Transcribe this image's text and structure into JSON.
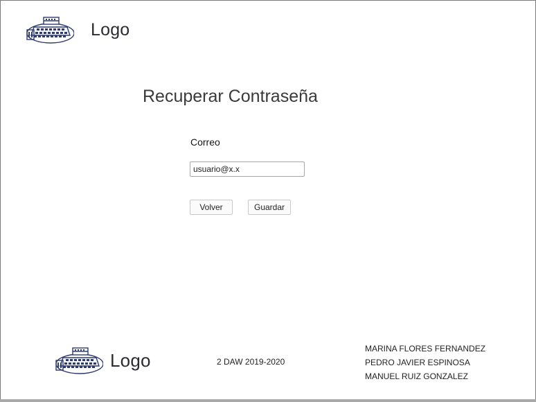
{
  "header": {
    "logo_text": "Logo",
    "logo_icon": "building-icon"
  },
  "main": {
    "title": "Recuperar Contraseña",
    "email_label": "Correo",
    "email_value": "usuario@x.x",
    "back_button": "Volver",
    "save_button": "Guardar"
  },
  "footer": {
    "logo_text": "Logo",
    "logo_icon": "building-icon",
    "course": "2 DAW 2019-2020",
    "authors": [
      "MARINA FLORES FERNANDEZ",
      "PEDRO JAVIER ESPINOSA",
      "MANUEL RUIZ GONZALEZ"
    ]
  },
  "colors": {
    "logo_ink": "#2e3a6e",
    "border": "#7a7a7a"
  }
}
